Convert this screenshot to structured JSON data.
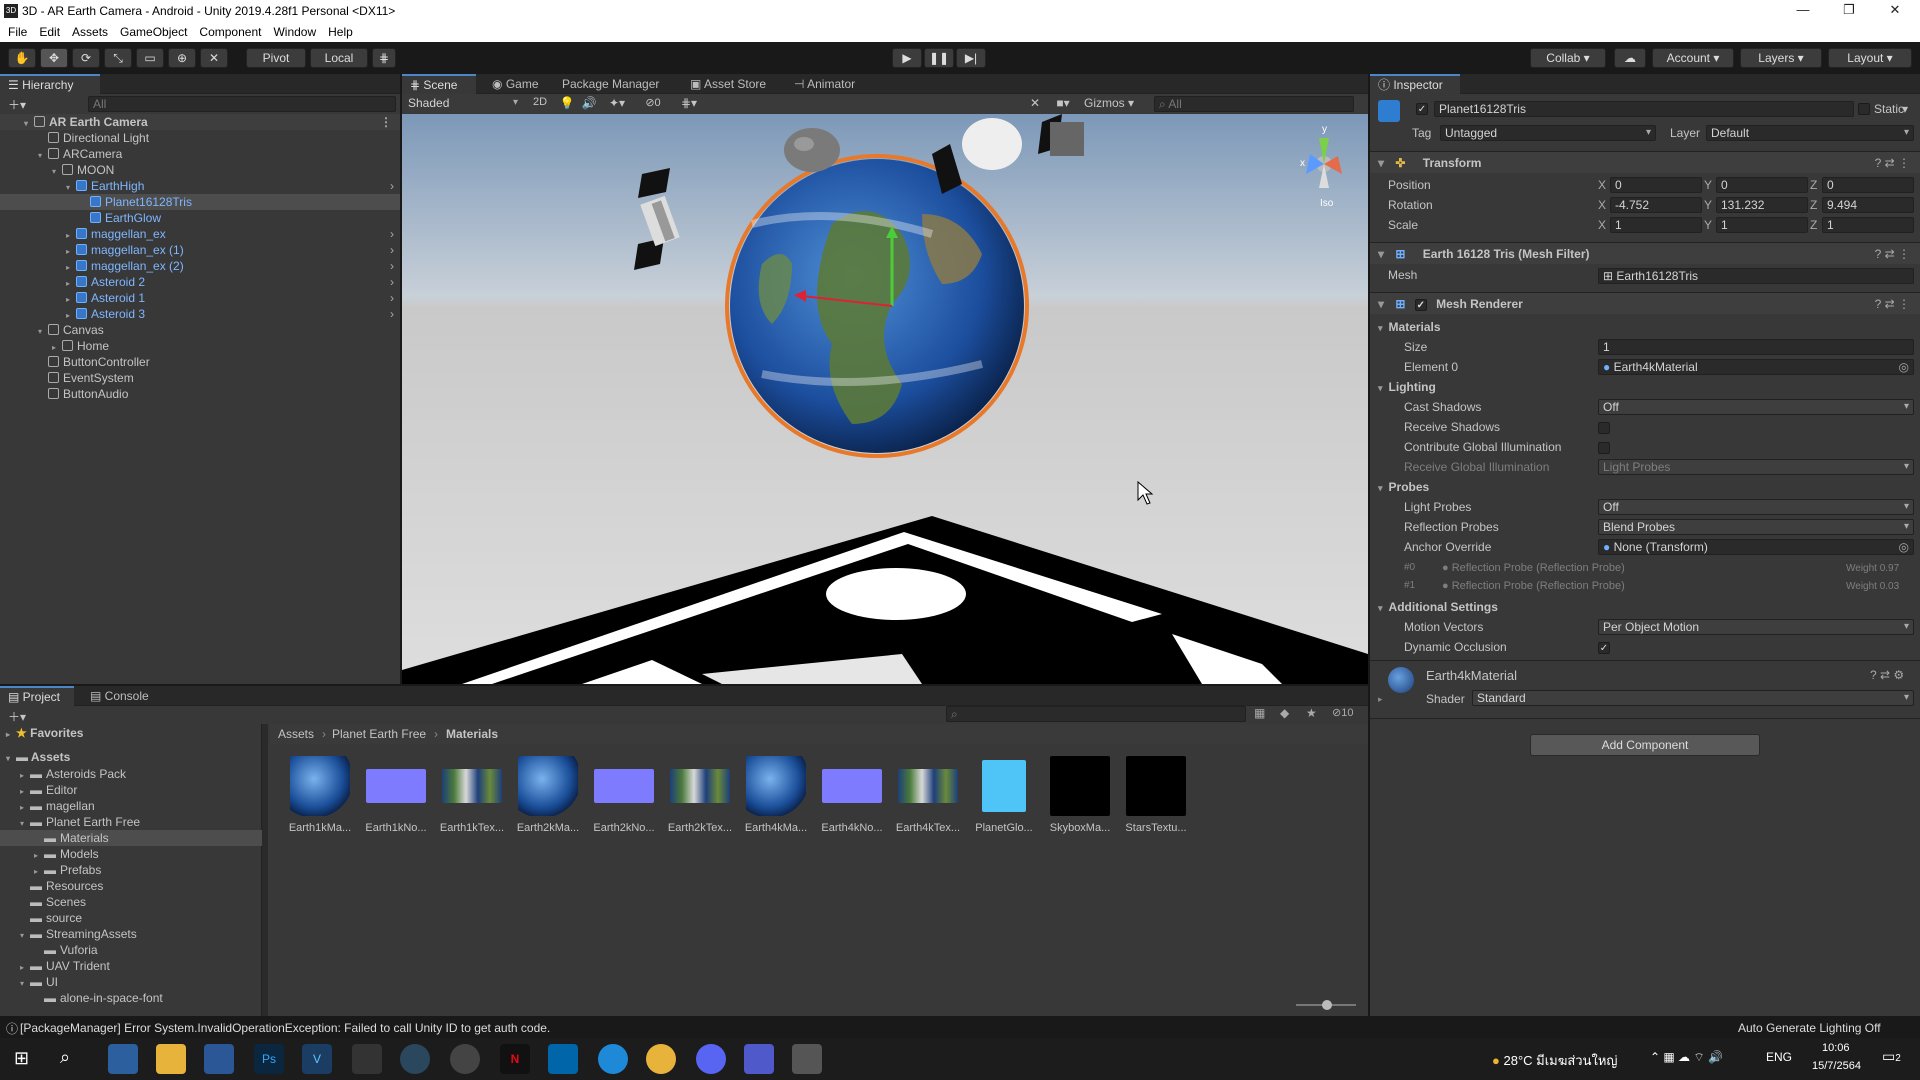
{
  "window": {
    "title": "3D - AR Earth Camera - Android - Unity 2019.4.28f1 Personal <DX11>",
    "minimize": "—",
    "maximize": "❐",
    "close": "✕"
  },
  "menu": [
    "File",
    "Edit",
    "Assets",
    "GameObject",
    "Component",
    "Window",
    "Help"
  ],
  "toolbar": {
    "pivot": "Pivot",
    "local": "Local",
    "collab": "Collab",
    "account": "Account",
    "layers": "Layers",
    "layout": "Layout"
  },
  "hierarchy": {
    "title": "Hierarchy",
    "search_placeholder": "All",
    "items": [
      {
        "label": "AR Earth Camera",
        "depth": 0,
        "root": true
      },
      {
        "label": "Directional Light",
        "depth": 1
      },
      {
        "label": "ARCamera",
        "depth": 1
      },
      {
        "label": "MOON",
        "depth": 2
      },
      {
        "label": "EarthHigh",
        "depth": 3,
        "prefab": true
      },
      {
        "label": "Planet16128Tris",
        "depth": 4,
        "prefab": true,
        "selected": true
      },
      {
        "label": "EarthGlow",
        "depth": 4,
        "prefab": true
      },
      {
        "label": "maggellan_ex",
        "depth": 3,
        "prefab": true
      },
      {
        "label": "maggellan_ex (1)",
        "depth": 3,
        "prefab": true
      },
      {
        "label": "maggellan_ex (2)",
        "depth": 3,
        "prefab": true
      },
      {
        "label": "Asteroid 2",
        "depth": 3,
        "prefab": true
      },
      {
        "label": "Asteroid 1",
        "depth": 3,
        "prefab": true
      },
      {
        "label": "Asteroid 3",
        "depth": 3,
        "prefab": true
      },
      {
        "label": "Canvas",
        "depth": 1
      },
      {
        "label": "Home",
        "depth": 2
      },
      {
        "label": "ButtonController",
        "depth": 1
      },
      {
        "label": "EventSystem",
        "depth": 1
      },
      {
        "label": "ButtonAudio",
        "depth": 1
      }
    ]
  },
  "scene": {
    "tabs": [
      "Scene",
      "Game",
      "Package Manager",
      "Asset Store",
      "Animator"
    ],
    "shading": "Shaded",
    "mode2d": "2D",
    "gizmos": "Gizmos",
    "search_placeholder": "All",
    "hidden_count": "0",
    "persp": "Iso"
  },
  "inspector": {
    "title": "Inspector",
    "object_name": "Planet16128Tris",
    "static_label": "Static",
    "tag_label": "Tag",
    "tag_value": "Untagged",
    "layer_label": "Layer",
    "layer_value": "Default",
    "transform": {
      "title": "Transform",
      "position": {
        "label": "Position",
        "x": "0",
        "y": "0",
        "z": "0"
      },
      "rotation": {
        "label": "Rotation",
        "x": "-4.752",
        "y": "131.232",
        "z": "9.494"
      },
      "scale": {
        "label": "Scale",
        "x": "1",
        "y": "1",
        "z": "1"
      }
    },
    "mesh_filter": {
      "title": "Earth 16128 Tris (Mesh Filter)",
      "mesh_label": "Mesh",
      "mesh_value": "Earth16128Tris"
    },
    "mesh_renderer": {
      "title": "Mesh Renderer",
      "materials": "Materials",
      "size_label": "Size",
      "size_value": "1",
      "element0_label": "Element 0",
      "element0_value": "Earth4kMaterial",
      "lighting": "Lighting",
      "cast_shadows_label": "Cast Shadows",
      "cast_shadows_value": "Off",
      "receive_shadows_label": "Receive Shadows",
      "contribute_gi_label": "Contribute Global Illumination",
      "receive_gi_label": "Receive Global Illumination",
      "receive_gi_value": "Light Probes",
      "probes": "Probes",
      "light_probes_label": "Light Probes",
      "light_probes_value": "Off",
      "reflection_probes_label": "Reflection Probes",
      "reflection_probes_value": "Blend Probes",
      "anchor_override_label": "Anchor Override",
      "anchor_override_value": "None (Transform)",
      "probe0_idx": "#0",
      "probe0": "Reflection Probe (Reflection Probe)",
      "probe0_weight": "Weight 0.97",
      "probe1_idx": "#1",
      "probe1": "Reflection Probe (Reflection Probe)",
      "probe1_weight": "Weight 0.03",
      "additional": "Additional Settings",
      "motion_vectors_label": "Motion Vectors",
      "motion_vectors_value": "Per Object Motion",
      "dynamic_occlusion_label": "Dynamic Occlusion"
    },
    "material": {
      "name": "Earth4kMaterial",
      "shader_label": "Shader",
      "shader_value": "Standard"
    },
    "add_component": "Add Component"
  },
  "project": {
    "tabs": [
      "Project",
      "Console"
    ],
    "favorites": "Favorites",
    "assets_root": "Assets",
    "tree": [
      "Asteroids Pack",
      "Editor",
      "magellan",
      "Planet Earth Free",
      "Materials",
      "Models",
      "Prefabs",
      "Resources",
      "Scenes",
      "source",
      "StreamingAssets",
      "Vuforia",
      "UAV Trident",
      "UI",
      "alone-in-space-font"
    ],
    "breadcrumb": [
      "Assets",
      "Planet Earth Free",
      "Materials"
    ],
    "hidden_count": "10",
    "assets": [
      {
        "label": "Earth1kMa...",
        "kind": "earth"
      },
      {
        "label": "Earth1kNo...",
        "kind": "normal"
      },
      {
        "label": "Earth1kTex...",
        "kind": "map"
      },
      {
        "label": "Earth2kMa...",
        "kind": "earth"
      },
      {
        "label": "Earth2kNo...",
        "kind": "normal"
      },
      {
        "label": "Earth2kTex...",
        "kind": "map"
      },
      {
        "label": "Earth4kMa...",
        "kind": "earth"
      },
      {
        "label": "Earth4kNo...",
        "kind": "normal"
      },
      {
        "label": "Earth4kTex...",
        "kind": "map"
      },
      {
        "label": "PlanetGlo...",
        "kind": "glow"
      },
      {
        "label": "SkyboxMa...",
        "kind": "black"
      },
      {
        "label": "StarsTextu...",
        "kind": "black"
      }
    ]
  },
  "status": {
    "message": "[PackageManager] Error System.InvalidOperationException: Failed to call Unity ID to get auth code.",
    "right": "Auto Generate Lighting Off"
  },
  "taskbar": {
    "weather": "28°C มีเมฆส่วนใหญ่",
    "lang": "ENG",
    "time": "10:06",
    "date": "15/7/2564",
    "notif": "2"
  }
}
